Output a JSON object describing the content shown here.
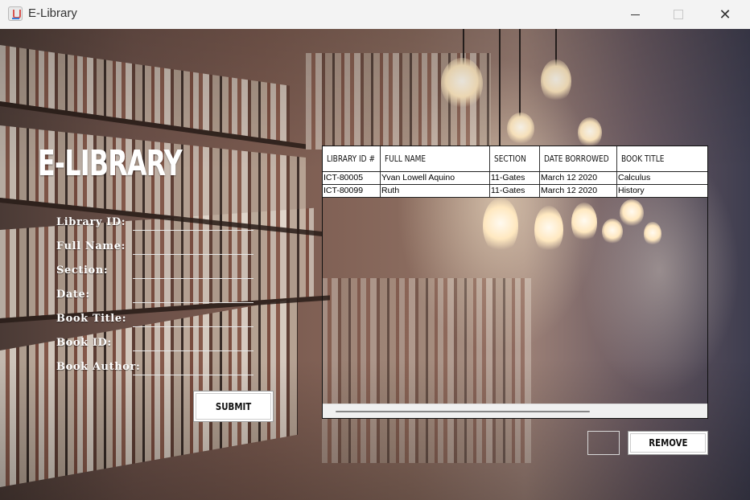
{
  "window": {
    "title": "E-Library"
  },
  "heading": "E-LIBRARY",
  "form": {
    "fields": [
      {
        "label": "Library ID:",
        "value": ""
      },
      {
        "label": "Full Name:",
        "value": ""
      },
      {
        "label": "Section:",
        "value": ""
      },
      {
        "label": "Date:",
        "value": ""
      },
      {
        "label": "Book Title:",
        "value": ""
      },
      {
        "label": "Book ID:",
        "value": ""
      },
      {
        "label": "Book Author:",
        "value": ""
      }
    ],
    "submit_label": "SUBMIT"
  },
  "table": {
    "columns": [
      "LIBRARY ID #",
      "FULL NAME",
      "SECTION",
      "DATE BORROWED",
      "BOOK TITLE"
    ],
    "rows": [
      [
        "ICT-80005",
        "Yvan Lowell Aquino",
        "11-Gates",
        "March 12 2020",
        "Calculus"
      ],
      [
        "ICT-80099",
        "Ruth",
        "11-Gates",
        "March 12 2020",
        "History"
      ]
    ]
  },
  "remove": {
    "input_value": "",
    "button_label": "REMOVE"
  },
  "icons": {
    "app": "java-cup-icon",
    "minimize": "minimize-icon",
    "maximize": "maximize-icon",
    "close": "close-icon"
  }
}
